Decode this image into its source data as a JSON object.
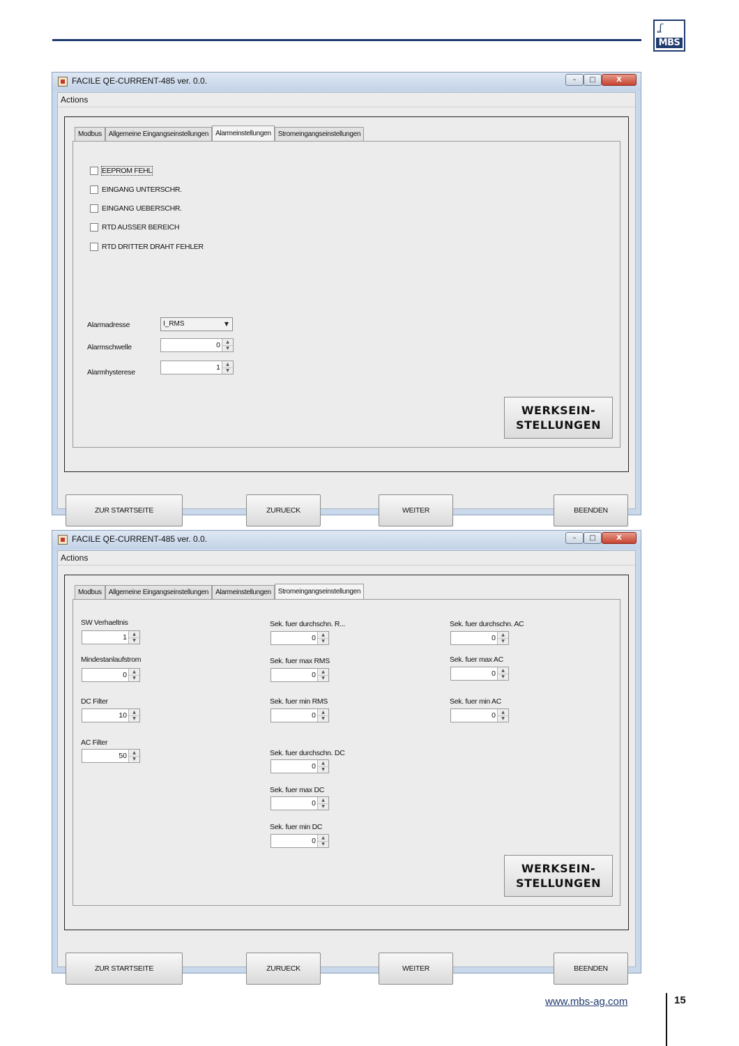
{
  "header": {
    "logo_text": "MBS",
    "accent": "#1f3a6e"
  },
  "windows": [
    {
      "title": "FACILE QE-CURRENT-485 ver. 0.0.",
      "controls": {
        "minimize": "–",
        "maximize": "□",
        "close": "X"
      },
      "menu": "Actions",
      "tabs": [
        "Modbus",
        "Allgemeine Eingangseinstellungen",
        "Alarmeinstellungen",
        "Stromeingangseinstellungen"
      ],
      "selected_tab": "Alarmeinstellungen",
      "alarm": {
        "checkboxes": [
          "EEPROM FEHL",
          "EINGANG UNTERSCHR.",
          "EINGANG UEBERSCHR.",
          "RTD AUSSER BEREICH",
          "RTD DRITTER DRAHT FEHLER"
        ],
        "alarmadresse_label": "Alarmadresse",
        "alarmadresse_value": "I_RMS",
        "alarmschwelle_label": "Alarmschwelle",
        "alarmschwelle_value": "0",
        "alarmhysterese_label": "Alarmhysterese",
        "alarmhysterese_value": "1"
      },
      "reset_button": [
        "WERKSEIN-",
        "STELLUNGEN"
      ],
      "nav": {
        "home": "ZUR STARTSEITE",
        "back": "ZURUECK",
        "next": "WEITER",
        "exit": "BEENDEN"
      }
    },
    {
      "title": "FACILE QE-CURRENT-485 ver. 0.0.",
      "controls": {
        "minimize": "–",
        "maximize": "□",
        "close": "X"
      },
      "menu": "Actions",
      "tabs": [
        "Modbus",
        "Allgemeine Eingangseinstellungen",
        "Alarmeinstellungen",
        "Stromeingangseinstellungen"
      ],
      "selected_tab": "Stromeingangseinstellungen",
      "current": {
        "col1": [
          {
            "label": "SW Verhaeltnis",
            "value": "1"
          },
          {
            "label": "Mindestanlaufstrom",
            "value": "0"
          },
          {
            "label": "DC Filter",
            "value": "10"
          },
          {
            "label": "AC Filter",
            "value": "50"
          }
        ],
        "col2": [
          {
            "label": "Sek. fuer durchschn. R...",
            "value": "0"
          },
          {
            "label": "Sek. fuer max RMS",
            "value": "0"
          },
          {
            "label": "Sek. fuer min RMS",
            "value": "0"
          },
          {
            "label": "Sek. fuer durchschn. DC",
            "value": "0"
          },
          {
            "label": "Sek. fuer max DC",
            "value": "0"
          },
          {
            "label": "Sek. fuer min DC",
            "value": "0"
          }
        ],
        "col3": [
          {
            "label": "Sek. fuer durchschn. AC",
            "value": "0"
          },
          {
            "label": "Sek. fuer max AC",
            "value": "0"
          },
          {
            "label": "Sek. fuer min AC",
            "value": "0"
          }
        ]
      },
      "reset_button": [
        "WERKSEIN-",
        "STELLUNGEN"
      ],
      "nav": {
        "home": "ZUR STARTSEITE",
        "back": "ZURUECK",
        "next": "WEITER",
        "exit": "BEENDEN"
      }
    }
  ],
  "footer": {
    "url": "www.mbs-ag.com",
    "page": "15"
  }
}
